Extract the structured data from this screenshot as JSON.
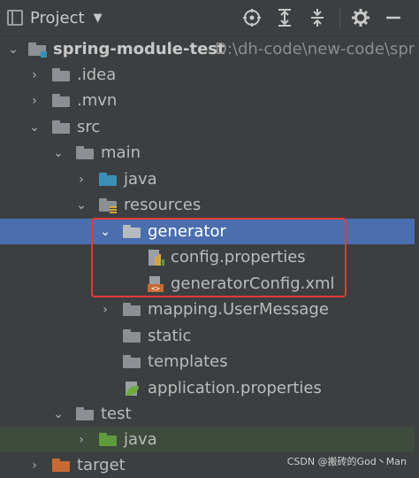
{
  "toolbar": {
    "title": "Project",
    "caret": "▼"
  },
  "tree": [
    {
      "label": "spring-module-test",
      "path": "D:\\dh-code\\new-code\\spri",
      "expanded": true,
      "icon": "module-folder-icon"
    },
    {
      "label": ".idea",
      "expanded": false,
      "icon": "folder-icon"
    },
    {
      "label": ".mvn",
      "expanded": false,
      "icon": "folder-icon"
    },
    {
      "label": "src",
      "expanded": true,
      "icon": "folder-icon"
    },
    {
      "label": "main",
      "expanded": true,
      "icon": "folder-icon"
    },
    {
      "label": "java",
      "expanded": false,
      "icon": "source-folder-icon"
    },
    {
      "label": "resources",
      "expanded": true,
      "icon": "resources-folder-icon"
    },
    {
      "label": "generator",
      "expanded": true,
      "icon": "folder-icon",
      "selected": true
    },
    {
      "label": "config.properties",
      "icon": "properties-file-icon"
    },
    {
      "label": "generatorConfig.xml",
      "icon": "xml-file-icon"
    },
    {
      "label": "mapping.UserMessage",
      "expanded": false,
      "icon": "folder-icon"
    },
    {
      "label": "static",
      "icon": "folder-icon"
    },
    {
      "label": "templates",
      "icon": "folder-icon"
    },
    {
      "label": "application.properties",
      "icon": "spring-properties-icon"
    },
    {
      "label": "test",
      "expanded": true,
      "icon": "folder-icon"
    },
    {
      "label": "java",
      "expanded": false,
      "icon": "test-source-folder-icon"
    },
    {
      "label": "target",
      "expanded": false,
      "icon": "excluded-folder-icon"
    }
  ],
  "watermark": "CSDN @搬砖的God丶Man",
  "colors": {
    "background": "#3c3f41",
    "selection": "#4b6eaf",
    "highlight_box": "#e53935"
  }
}
